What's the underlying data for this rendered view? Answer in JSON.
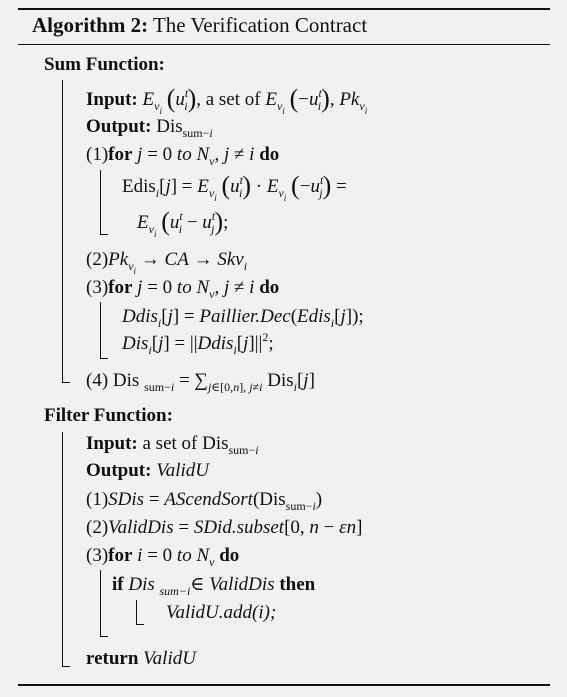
{
  "title": {
    "label": "Algorithm 2:",
    "text": "The Verification Contract"
  },
  "sum_function": {
    "header": "Sum Function:",
    "input": {
      "label": "Input:",
      "text": ", a set of "
    },
    "output": {
      "label": "Output:",
      "text": "Dis"
    },
    "step1": {
      "num": "(1)",
      "keyword_for": "for",
      "keyword_do": "do",
      "body_line1_lhs": "Edis",
      "body_line2": "E"
    },
    "step2": {
      "num": "(2)",
      "text": "CA",
      "arrow": "→"
    },
    "step3": {
      "num": "(3)",
      "keyword_for": "for",
      "keyword_do": "do",
      "body_line1": "Ddis",
      "body_line2": "Dis"
    },
    "step4": {
      "num": "(4) Dis"
    }
  },
  "filter_function": {
    "header": "Filter Function:",
    "input": {
      "label": "Input:",
      "text": "a set of  Dis"
    },
    "output": {
      "label": "Output:",
      "text": "ValidU"
    },
    "step1": {
      "num": "(1)"
    },
    "step2": {
      "num": "(2)"
    },
    "step3": {
      "num": "(3)",
      "keyword_for": "for",
      "keyword_do": "do"
    },
    "if_line": {
      "keyword_if": "if",
      "keyword_then": "then"
    },
    "add_line": "ValidU.add(i);",
    "return_line": {
      "keyword": "return",
      "value": "ValidU"
    }
  }
}
